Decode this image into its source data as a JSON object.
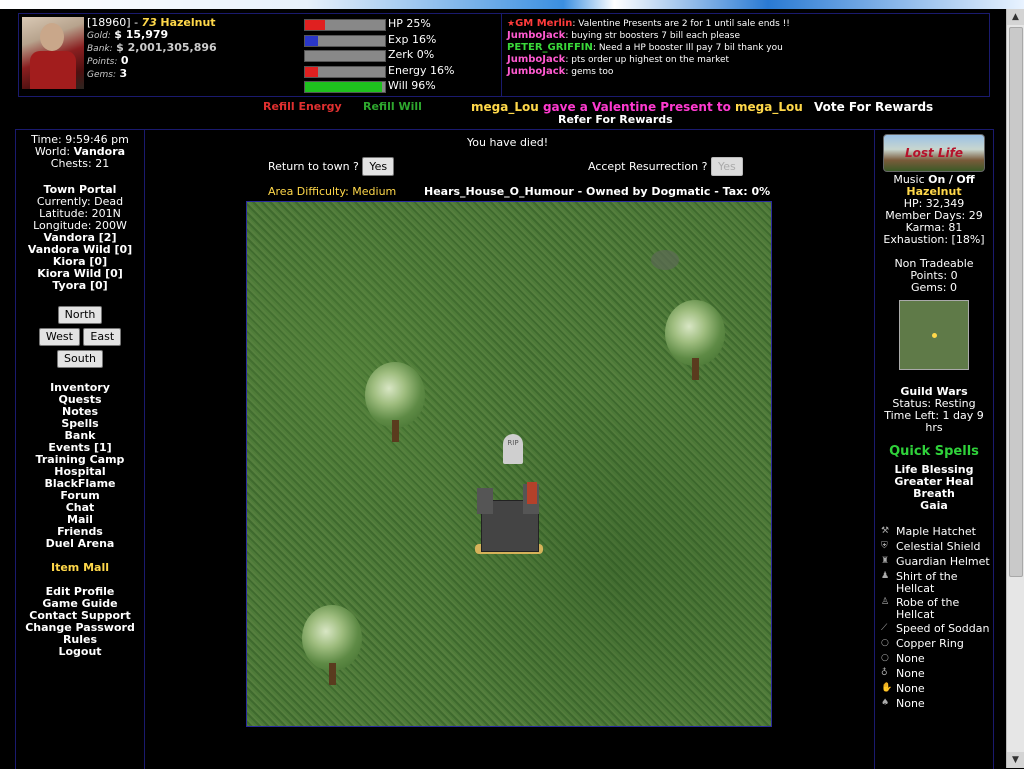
{
  "player": {
    "id_text": "[18960] -",
    "level": "73",
    "name": "Hazelnut",
    "gold_label": "Gold:",
    "gold": "$ 15,979",
    "bank_label": "Bank:",
    "bank": "$ 2,001,305,896",
    "points_label": "Points:",
    "points": "0",
    "gems_label": "Gems:",
    "gems": "3"
  },
  "bars": [
    {
      "label": "HP 25%",
      "pct": 25,
      "color": "#e02020"
    },
    {
      "label": "Exp 16%",
      "pct": 16,
      "color": "#2a37c8"
    },
    {
      "label": "Zerk 0%",
      "pct": 0,
      "color": "#777"
    },
    {
      "label": "Energy 16%",
      "pct": 16,
      "color": "#e02020"
    },
    {
      "label": "Will 96%",
      "pct": 96,
      "color": "#1ec21e"
    }
  ],
  "chat": [
    {
      "name": "GM Merlin",
      "color": "#ff3b3b",
      "msg": "Valentine Presents are 2 for 1 until sale ends !!"
    },
    {
      "name": "JumboJack",
      "color": "#ff5ad0",
      "msg": "buying str boosters 7 bill each please"
    },
    {
      "name": "PETER_GRIFFIN",
      "color": "#3ad83a",
      "msg": "Need a HP booster Ill pay 7 bil thank you"
    },
    {
      "name": "JumboJack",
      "color": "#ff5ad0",
      "msg": "pts order up highest on the market"
    },
    {
      "name": "JumboJack",
      "color": "#ff5ad0",
      "msg": "gems too"
    }
  ],
  "links": {
    "refill_energy": "Refill Energy",
    "refill_will": "Refill Will",
    "present_from": "mega_Lou",
    "present_mid": " gave a Valentine Present to ",
    "present_to": "mega_Lou",
    "vote": "Vote For Rewards",
    "refer": "Refer For Rewards"
  },
  "left": {
    "time": "Time: 9:59:46 pm",
    "world_label": "World:",
    "world": "Vandora",
    "chests": "Chests: 21",
    "town_portal": "Town Portal",
    "currently": "Currently: Dead",
    "latitude": "Latitude: 201N",
    "longitude": "Longitude: 200W",
    "zones": [
      "Vandora [2]",
      "Vandora Wild [0]",
      "Kiora [0]",
      "Kiora Wild [0]",
      "Tyora [0]"
    ],
    "north": "North",
    "west": "West",
    "east": "East",
    "south": "South",
    "menu": [
      "Inventory",
      "Quests",
      "Notes",
      "Spells",
      "Bank",
      "Events [1]",
      "Training Camp",
      "Hospital",
      "BlackFlame",
      "Forum",
      "Chat",
      "Mail",
      "Friends",
      "Duel Arena"
    ],
    "item_mall": "Item Mall",
    "menu2": [
      "Edit Profile",
      "Game Guide",
      "Contact Support",
      "Change Password",
      "Rules",
      "Logout"
    ]
  },
  "center": {
    "died": "You have died!",
    "return_text": "Return to town ?",
    "yes1": "Yes",
    "accept_text": "Accept Resurrection ?",
    "yes2": "Yes",
    "area": "Area Difficulty: Medium",
    "house": "Hears_House_O_Humour - Owned by Dogmatic - Tax: 0%",
    "grave_text": "RIP"
  },
  "right": {
    "logo_text": "Lost Life",
    "music_label": "Music",
    "music_on": "On",
    "music_sep": "/",
    "music_off": "Off",
    "name": "Hazelnut",
    "hp": "HP: 32,349",
    "member_days": "Member Days: 29",
    "karma": "Karma: 81",
    "exhaustion": "Exhaustion: [18%]",
    "non_tradeable": "Non Tradeable",
    "nt_points": "Points: 0",
    "nt_gems": "Gems: 0",
    "guild_wars": "Guild Wars",
    "gw_status": "Status: Resting",
    "gw_time": "Time Left: 1 day 9 hrs",
    "quick_spells": "Quick Spells",
    "spells": [
      "Life Blessing",
      "Greater Heal",
      "Breath",
      "Gaia"
    ],
    "equipment": [
      {
        "icon": "axe-icon",
        "glyph": "⚒",
        "name": "Maple Hatchet"
      },
      {
        "icon": "shield-icon",
        "glyph": "⛨",
        "name": "Celestial Shield"
      },
      {
        "icon": "helmet-icon",
        "glyph": "♜",
        "name": "Guardian Helmet"
      },
      {
        "icon": "shirt-icon",
        "glyph": "♟",
        "name": "Shirt of the Hellcat"
      },
      {
        "icon": "robe-icon",
        "glyph": "♙",
        "name": "Robe of the Hellcat"
      },
      {
        "icon": "boots-icon",
        "glyph": "⟋",
        "name": "Speed of Soddan"
      },
      {
        "icon": "ring-icon",
        "glyph": "○",
        "name": "Copper Ring"
      },
      {
        "icon": "ring-icon",
        "glyph": "○",
        "name": "None"
      },
      {
        "icon": "amulet-icon",
        "glyph": "♁",
        "name": "None"
      },
      {
        "icon": "gloves-icon",
        "glyph": "✋",
        "name": "None"
      },
      {
        "icon": "charm-icon",
        "glyph": "♠",
        "name": "None"
      }
    ]
  }
}
